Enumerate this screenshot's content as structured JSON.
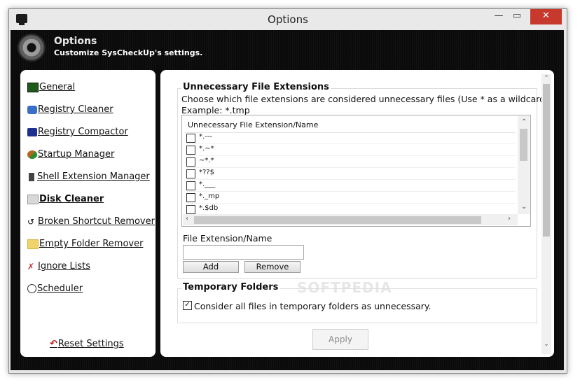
{
  "window": {
    "title": "Options",
    "min_label": "—",
    "max_label": "▭",
    "close_label": "✕"
  },
  "header": {
    "title": "Options",
    "subtitle": "Customize SysCheckUp's settings."
  },
  "sidebar": {
    "items": [
      {
        "label": "General",
        "icon": "monitor-icon",
        "color": "#1f5a1a"
      },
      {
        "label": "Registry Cleaner",
        "icon": "registry-cleaner-icon",
        "color": "#3a6fc7"
      },
      {
        "label": "Registry Compactor",
        "icon": "cube-icon",
        "color": "#1d2f8f"
      },
      {
        "label": "Startup Manager",
        "icon": "startup-icon",
        "color": "#b5651d"
      },
      {
        "label": "Shell Extension Manager",
        "icon": "plug-icon",
        "color": "#444444"
      },
      {
        "label": "Disk Cleaner",
        "icon": "disk-icon",
        "color": "#bdbdbd"
      },
      {
        "label": "Broken Shortcut Remover",
        "icon": "shortcut-icon",
        "color": "#333333"
      },
      {
        "label": "Empty Folder Remover",
        "icon": "folder-icon",
        "color": "#f1d36b"
      },
      {
        "label": "Ignore Lists",
        "icon": "ignore-list-icon",
        "color": "#c23030"
      },
      {
        "label": "Scheduler",
        "icon": "clock-icon",
        "color": "#333333"
      }
    ],
    "active": "Disk Cleaner",
    "reset_label": "Reset Settings"
  },
  "main": {
    "group1_title": "Unnecessary File Extensions",
    "description_line1": "Choose which file extensions are considered unnecessary files (Use * as a wildcard):",
    "description_line2": "Example: *.tmp",
    "list_header": "Unnecessary File Extension/Name",
    "list_items": [
      "*.---",
      "*.~*",
      "~*.*",
      "*??$",
      "*.___",
      "*._mp",
      "*.$db"
    ],
    "field_label": "File Extension/Name",
    "field_value": "",
    "add_label": "Add",
    "remove_label": "Remove",
    "group2_title": "Temporary Folders",
    "temp_checkbox_label": "Consider all files in temporary folders as unnecessary.",
    "temp_checked": true,
    "apply_label": "Apply",
    "watermark": "SOFTPEDIA"
  }
}
